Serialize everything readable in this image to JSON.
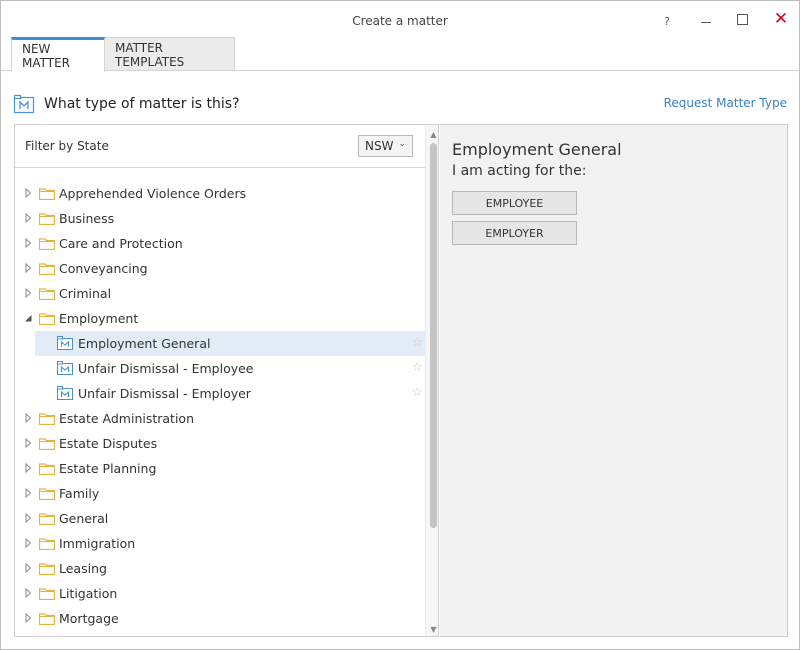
{
  "window": {
    "title": "Create a matter",
    "help_glyph": "?",
    "close_glyph": "✕"
  },
  "tabs": [
    {
      "label": "NEW MATTER"
    },
    {
      "label": "MATTER TEMPLATES"
    }
  ],
  "header": {
    "question": "What type of matter is this?",
    "request_link": "Request Matter Type"
  },
  "filter": {
    "label": "Filter by State",
    "state_value": "NSW"
  },
  "tree": {
    "categories": [
      {
        "label": "Apprehended Violence Orders"
      },
      {
        "label": "Business"
      },
      {
        "label": "Care and Protection"
      },
      {
        "label": "Conveyancing"
      },
      {
        "label": "Criminal"
      },
      {
        "label": "Employment"
      },
      {
        "label": "Estate Administration"
      },
      {
        "label": "Estate Disputes"
      },
      {
        "label": "Estate Planning"
      },
      {
        "label": "Family"
      },
      {
        "label": "General"
      },
      {
        "label": "Immigration"
      },
      {
        "label": "Leasing"
      },
      {
        "label": "Litigation"
      },
      {
        "label": "Mortgage"
      }
    ],
    "employment_children": [
      {
        "label": "Employment General"
      },
      {
        "label": "Unfair Dismissal - Employee"
      },
      {
        "label": "Unfair Dismissal - Employer"
      }
    ],
    "selected": "Employment General"
  },
  "detail": {
    "title": "Employment General",
    "subtitle": "I am acting for the:",
    "employee_button": "EMPLOYEE",
    "employer_button": "EMPLOYER"
  },
  "colors": {
    "accent": "#3c8fd6",
    "link": "#3b82c6",
    "folder": "#e8b33c",
    "selected_row": "#e1ecf7",
    "close": "#d0021b"
  }
}
